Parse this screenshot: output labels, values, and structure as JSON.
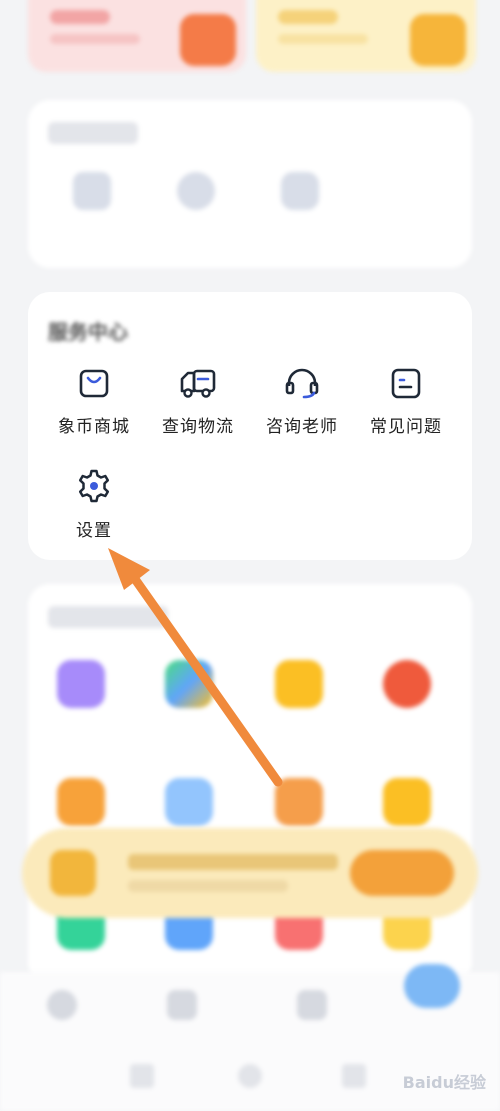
{
  "colors": {
    "accent": "#f08a3c",
    "icon_blue": "#3b5bdb",
    "icon_dark": "#1f2937"
  },
  "service_center": {
    "title": "服务中心",
    "items": [
      {
        "label": "象币商城",
        "icon": "shopping-bag-icon"
      },
      {
        "label": "查询物流",
        "icon": "delivery-truck-icon"
      },
      {
        "label": "咨询老师",
        "icon": "headset-icon"
      },
      {
        "label": "常见问题",
        "icon": "faq-card-icon"
      },
      {
        "label": "设置",
        "icon": "settings-gear-icon"
      }
    ]
  },
  "watermark": "Baidu经验"
}
